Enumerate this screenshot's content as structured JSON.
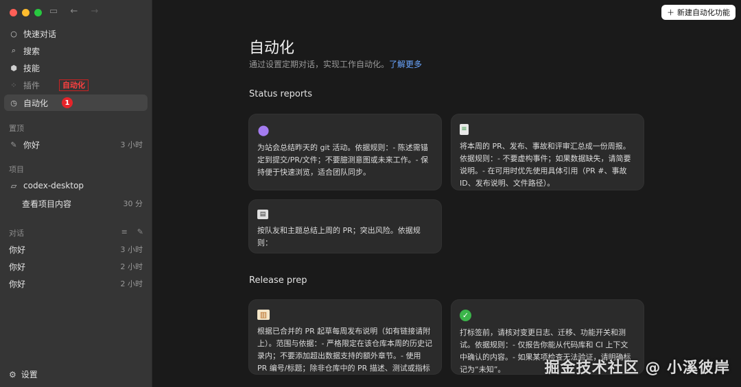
{
  "window": {
    "traffic_colors": [
      "#ff5f57",
      "#febc2e",
      "#28c840"
    ]
  },
  "sidebar": {
    "nav": [
      {
        "label": "快速对话",
        "icon": "chat-bubble-icon"
      },
      {
        "label": "搜索",
        "icon": "search-icon"
      },
      {
        "label": "技能",
        "icon": "cube-icon"
      },
      {
        "label": "插件",
        "icon": "grid-icon"
      },
      {
        "label": "自动化",
        "icon": "clock-icon"
      }
    ],
    "annotation_label": "自动化",
    "annotation_badge": "1",
    "pinned_header": "置顶",
    "pinned": [
      {
        "label": "你好",
        "meta": "3 小时"
      }
    ],
    "projects_header": "项目",
    "project_name": "codex-desktop",
    "project_child": {
      "label": "查看项目内容",
      "meta": "30 分"
    },
    "chats_header": "对话",
    "chats": [
      {
        "label": "你好",
        "meta": "3 小时"
      },
      {
        "label": "你好",
        "meta": "2 小时"
      },
      {
        "label": "你好",
        "meta": "2 小时"
      }
    ],
    "settings_label": "设置"
  },
  "main": {
    "new_button": "新建自动化功能",
    "title": "自动化",
    "subtitle": "通过设置定期对话，实现工作自动化。",
    "learn_more": "了解更多",
    "status_header": "Status reports",
    "status_cards": [
      {
        "icon": "purple-shapes-icon",
        "text": "为站会总结昨天的 git 活动。依据规则：- 陈述需锚定到提交/PR/文件；不要臆测意图或未来工作。- 保持便于快速浏览，适合团队同步。"
      },
      {
        "icon": "document-icon",
        "text": "将本周的 PR、发布、事故和评审汇总成一份周报。依据规则：- 不要虚构事件；如果数据缺失，请简要说明。- 在可用时优先使用具体引用（PR #、事故 ID、发布说明、文件路径）。"
      },
      {
        "icon": "newspaper-icon",
        "text": "按队友和主题总结上周的 PR；突出风险。依据规则："
      }
    ],
    "release_header": "Release prep",
    "release_cards": [
      {
        "icon": "book-icon",
        "text": "根据已合并的 PR 起草每周发布说明（如有链接请附上）。范围与依据：- 严格限定在该仓库本周的历史记录内；不要添加超出数据支持的额外章节。- 使用 PR 编号/标题；除非仓库中的 PR 描述、测试或指标支持，否则避免对影响作出推论。"
      },
      {
        "icon": "check-circle-icon",
        "text": "打标签前，请核对变更日志、迁移、功能开关和测试。依据规则：- 仅报告你能从代码库和 CI 上下文中确认的内容。- 如果某项检查无法验证，请明确标记为“未知”。"
      }
    ]
  },
  "watermark": "掘金技术社区 @ 小溪彼岸"
}
